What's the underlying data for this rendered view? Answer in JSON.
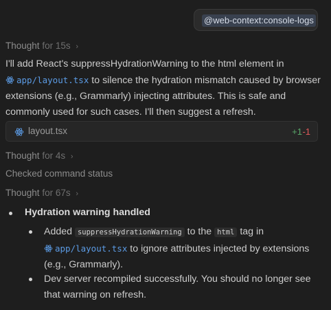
{
  "user_message": {
    "mention": "@web-context:console-logs"
  },
  "thoughts": [
    {
      "word": "Thought",
      "duration": "for 15s"
    },
    {
      "word": "Thought",
      "duration": "for 4s"
    },
    {
      "word": "Thought",
      "duration": "for 67s"
    }
  ],
  "response": {
    "p1_part1": "I'll add React's suppressHydrationWarning to the html element in",
    "p1_link": "app/layout.tsx",
    "p1_part2": " to silence the hydration mismatch caused by browser extensions (e.g., Grammarly) injecting attributes. This is safe and commonly used for such cases. I'll then suggest a refresh."
  },
  "file_change": {
    "name": "layout.tsx",
    "additions": "+1",
    "deletions": "-1"
  },
  "status": "Checked command status",
  "summary": {
    "heading": "Hydration warning handled",
    "item1_a": "Added ",
    "item1_code1": "suppressHydrationWarning",
    "item1_b": " to the ",
    "item1_code2": "html",
    "item1_c": " tag in",
    "item1_link": "app/layout.tsx",
    "item1_d": " to ignore attributes injected by extensions (e.g., Grammarly).",
    "item2": "Dev server recompiled successfully. You should no longer see that warning on refresh."
  },
  "colors": {
    "background": "#1e1e1e",
    "link": "#5c9ce6",
    "additions": "#59a869",
    "deletions": "#e05a5a"
  }
}
